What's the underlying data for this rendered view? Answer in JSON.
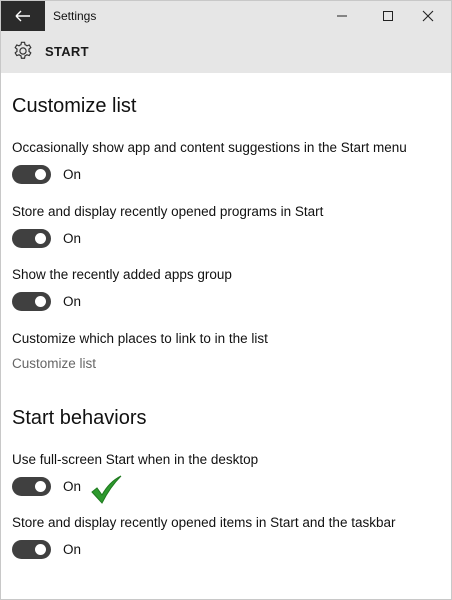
{
  "window": {
    "title": "Settings"
  },
  "header": {
    "title": "START",
    "icon": "gear-icon"
  },
  "sections": {
    "customize": {
      "title": "Customize list",
      "settings": [
        {
          "label": "Occasionally show app and content suggestions in the Start menu",
          "state": "On"
        },
        {
          "label": "Store and display recently opened programs in Start",
          "state": "On"
        },
        {
          "label": "Show the recently added apps group",
          "state": "On"
        }
      ],
      "places_label": "Customize which places to link to in the list",
      "places_link": "Customize list"
    },
    "behaviors": {
      "title": "Start behaviors",
      "settings": [
        {
          "label": "Use full-screen Start when in the desktop",
          "state": "On"
        },
        {
          "label": "Store and display recently opened items in Start and the taskbar",
          "state": "On"
        }
      ]
    }
  },
  "colors": {
    "toggle_on": "#404040",
    "titlebar": "#e6e6e6",
    "back_button": "#2b2b2b",
    "checkmark": "#2e9a2e"
  }
}
